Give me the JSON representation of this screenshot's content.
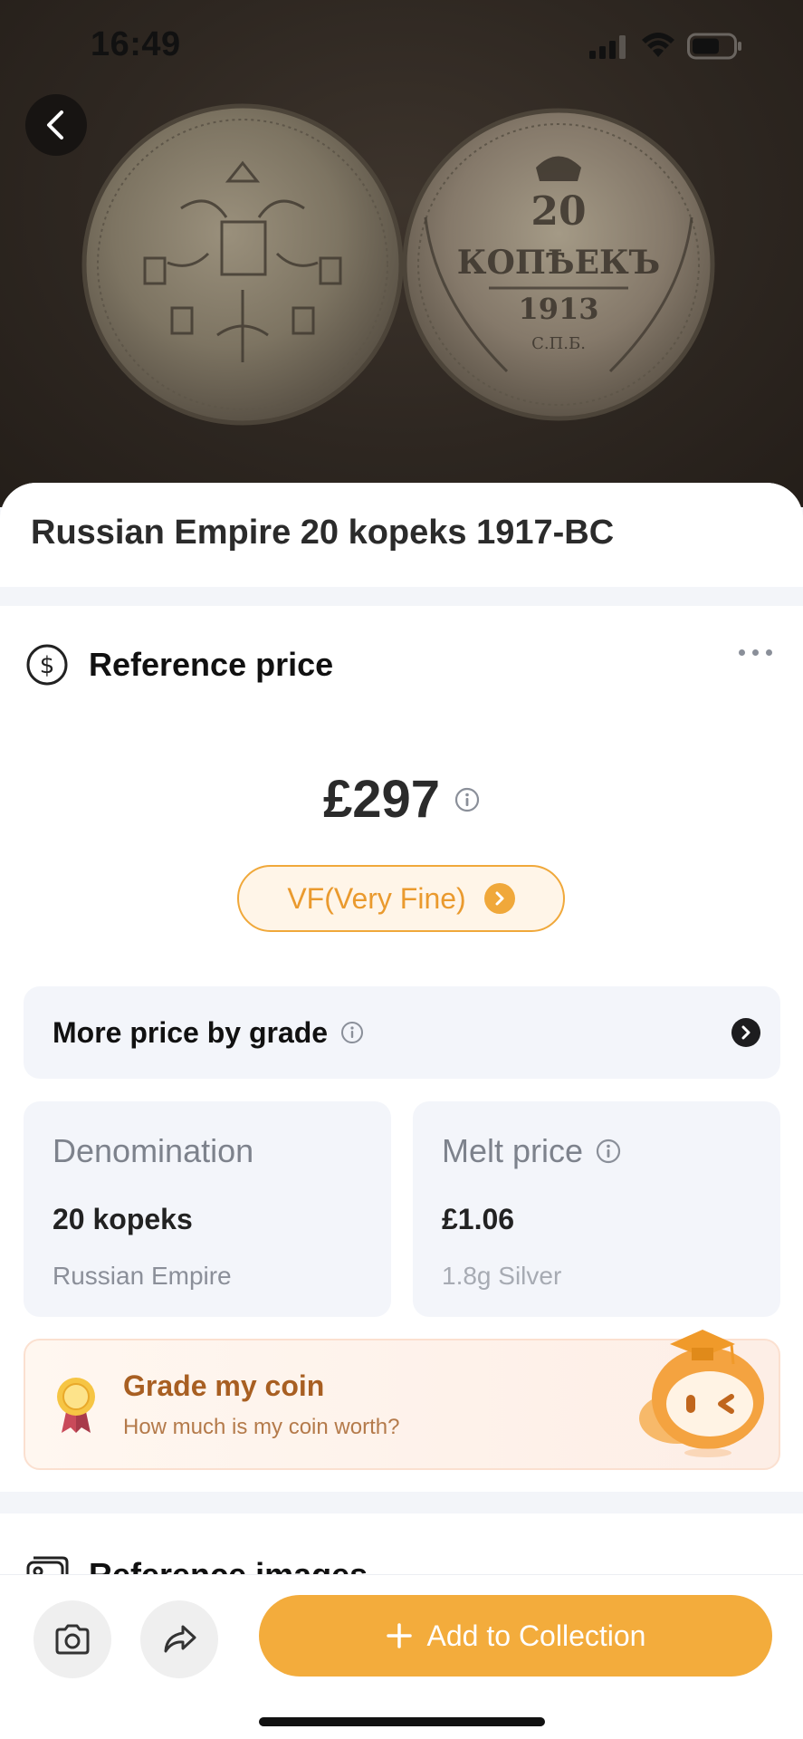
{
  "status_bar": {
    "time": "16:49"
  },
  "coin": {
    "title": "Russian Empire 20 kopeks 1917-BC"
  },
  "reference_price": {
    "title": "Reference price",
    "price": "£297",
    "grade": "VF(Very Fine)",
    "more_by_grade": "More price by grade"
  },
  "denomination": {
    "label": "Denomination",
    "value": "20 kopeks",
    "sub": "Russian Empire"
  },
  "melt_price": {
    "label": "Melt price",
    "value": "£1.06",
    "sub": "1.8g Silver"
  },
  "grade_my_coin": {
    "title": "Grade my coin",
    "subtitle": "How much is my coin worth?"
  },
  "reference_images": {
    "title": "Reference images"
  },
  "bottom_bar": {
    "add_label": "Add to Collection"
  },
  "colors": {
    "accent": "#f3ac3c",
    "accent_text": "#ea9a2e",
    "grade_title": "#a85f22"
  },
  "icons": [
    "back-arrow-icon",
    "dollar-circle-icon",
    "more-dots-icon",
    "info-icon",
    "chevron-right-icon",
    "medal-icon",
    "mascot-icon",
    "image-icon",
    "camera-icon",
    "share-icon",
    "plus-icon"
  ]
}
